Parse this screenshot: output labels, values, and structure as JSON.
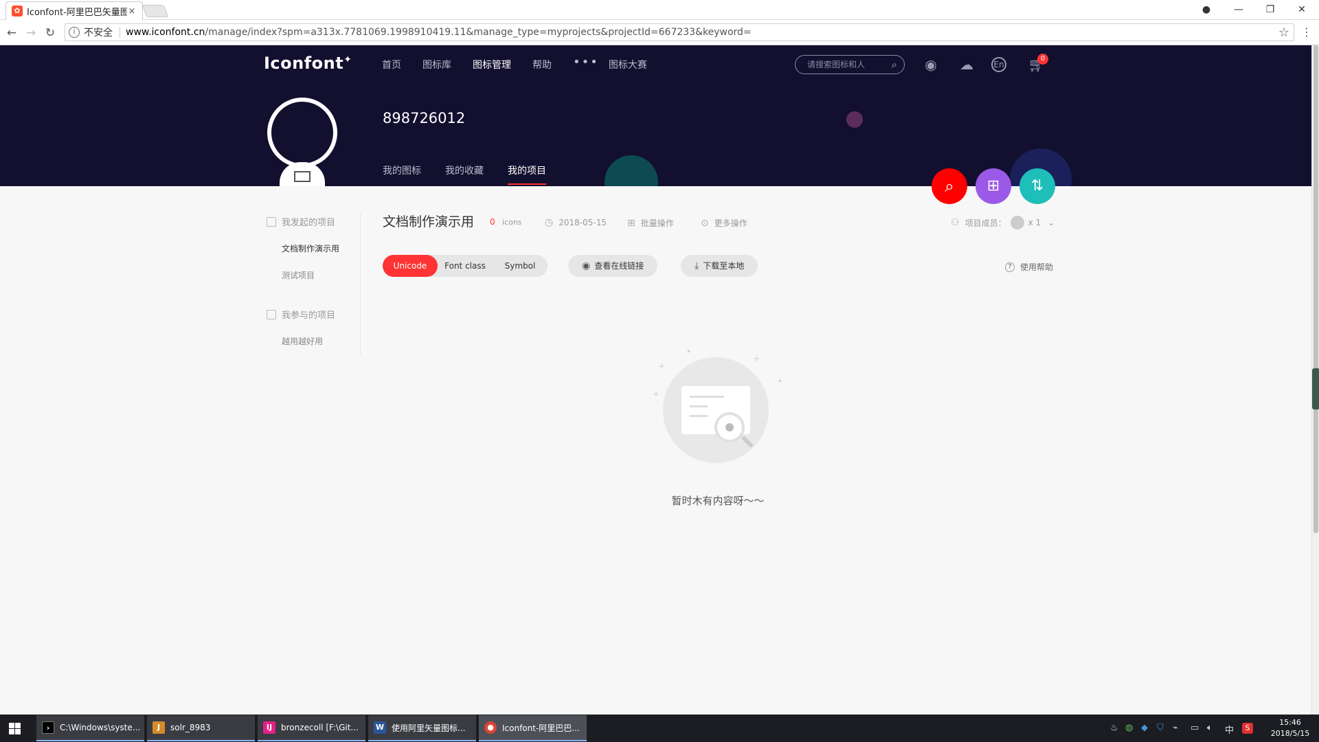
{
  "browser": {
    "tab_title": "Iconfont-阿里巴巴矢量图",
    "tab_close": "×",
    "insecure_label": "不安全",
    "url_domain": "www.iconfont.cn",
    "url_path": "/manage/index?spm=a313x.7781069.1998910419.11&manage_type=myprojects&projectId=667233&keyword=",
    "star": "☆",
    "menu": "⋮"
  },
  "header": {
    "logo": "Iconfont",
    "nav": [
      "首页",
      "图标库",
      "图标管理",
      "帮助",
      "•••",
      "图标大赛"
    ],
    "search_placeholder": "请搜索图标和人",
    "lang_label": "En",
    "cart_count": "0",
    "username": "898726012",
    "sub_nav": [
      "我的图标",
      "我的收藏",
      "我的项目"
    ]
  },
  "sidebar": {
    "group1": "我发起的项目",
    "group1_items": [
      "文档制作演示用",
      "测试项目"
    ],
    "group2": "我参与的项目",
    "group2_items": [
      "越用越好用"
    ]
  },
  "project": {
    "title": "文档制作演示用",
    "count": "0",
    "count_label": "icons",
    "date": "2018-05-15",
    "batch": "批量操作",
    "more": "更多操作",
    "members_label": "项目成员：",
    "members_count": "x 1",
    "tabs": [
      "Unicode",
      "Font class",
      "Symbol"
    ],
    "view_online": "查看在线链接",
    "download": "下载至本地",
    "help": "使用帮助",
    "empty_text": "暂时木有内容呀～～"
  },
  "taskbar": {
    "tasks": [
      {
        "label": "C:\\Windows\\syste...",
        "color": "#000000"
      },
      {
        "label": "solr_8983",
        "color": "#d58b2c"
      },
      {
        "label": "bronzecoll [F:\\Git...",
        "color": "#e4208a"
      },
      {
        "label": "使用阿里矢量图标...",
        "color": "#2b579a"
      },
      {
        "label": "Iconfont-阿里巴巴...",
        "color": "#db4437"
      }
    ],
    "ime": "中",
    "time": "15:46",
    "date": "2018/5/15"
  },
  "colors": {
    "header_bg": "#120f2f",
    "accent_red": "#ff3333",
    "fab_red": "#ff0000",
    "fab_purple": "#9b59e8",
    "fab_teal": "#1dbfb8"
  }
}
